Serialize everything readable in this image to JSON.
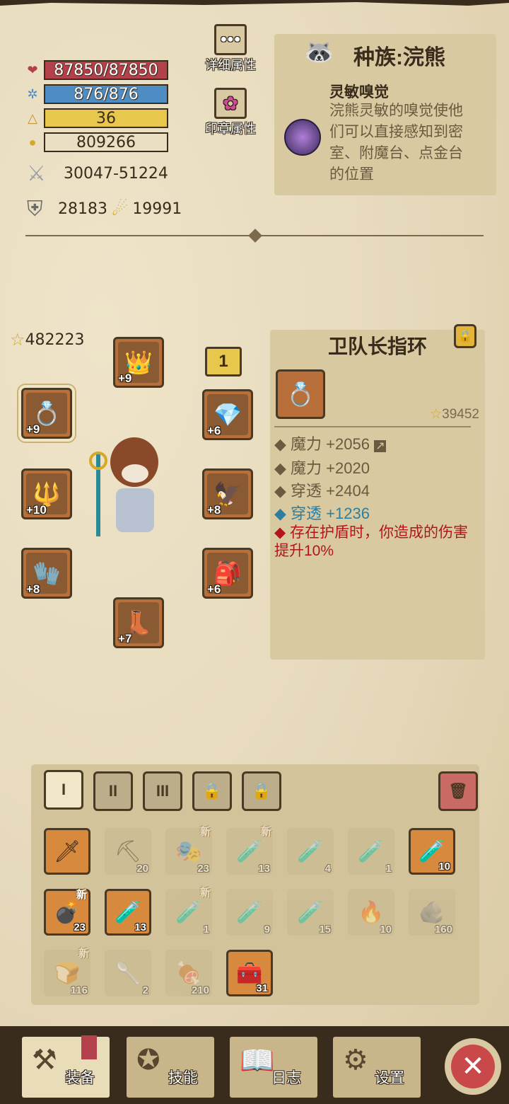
{
  "stats": {
    "hp": "87850/87850",
    "mp": "876/876",
    "level": "36",
    "gold": "809266",
    "attack": "30047-51224",
    "defense": "28183",
    "speed": "19991"
  },
  "buttons": {
    "detail_attr": "详细属性",
    "seal_attr": "印章属性"
  },
  "race": {
    "title": "种族:浣熊",
    "skill_name": "灵敏嗅觉",
    "skill_desc": "浣熊灵敏的嗅觉使他们可以直接感知到密室、附魔台、点金台的位置"
  },
  "equipment": {
    "total_score": "482223",
    "page_index": "1",
    "slots": [
      {
        "name": "helm",
        "level": "+9"
      },
      {
        "name": "ring",
        "level": "+9"
      },
      {
        "name": "amulet",
        "level": "+6"
      },
      {
        "name": "staff",
        "level": "+10"
      },
      {
        "name": "armor",
        "level": "+8"
      },
      {
        "name": "glove",
        "level": "+8"
      },
      {
        "name": "belt",
        "level": "+6"
      },
      {
        "name": "boots",
        "level": "+7"
      }
    ]
  },
  "item_detail": {
    "title": "卫队长指环",
    "score": "39452",
    "attr1": "魔力 +2056",
    "attr2": "魔力 +2020",
    "attr3": "穿透 +2404",
    "attr4": "穿透 +1236",
    "special": "存在护盾时，你造成的伤害提升10%",
    "colors": {
      "special": "#b3151b",
      "blue": "#2d7fa0"
    }
  },
  "inventory": {
    "tabs": [
      "I",
      "II",
      "III"
    ],
    "items": [
      {
        "icon": "sword",
        "count": "",
        "new": false,
        "dim": false
      },
      {
        "icon": "pickaxe",
        "count": "20",
        "new": false,
        "dim": true
      },
      {
        "icon": "mask",
        "count": "23",
        "new": true,
        "dim": true
      },
      {
        "icon": "potion-red",
        "count": "13",
        "new": true,
        "dim": true
      },
      {
        "icon": "potion-green",
        "count": "4",
        "new": false,
        "dim": true
      },
      {
        "icon": "potion-red",
        "count": "1",
        "new": false,
        "dim": true
      },
      {
        "icon": "potion-yellow",
        "count": "10",
        "new": false,
        "dim": false
      },
      {
        "icon": "bomb",
        "count": "23",
        "new": true,
        "dim": false
      },
      {
        "icon": "potion-pink",
        "count": "13",
        "new": false,
        "dim": false
      },
      {
        "icon": "potion-red",
        "count": "1",
        "new": true,
        "dim": true
      },
      {
        "icon": "potion-blue",
        "count": "9",
        "new": false,
        "dim": true
      },
      {
        "icon": "potion-red",
        "count": "15",
        "new": false,
        "dim": true
      },
      {
        "icon": "potion-fire",
        "count": "10",
        "new": false,
        "dim": true
      },
      {
        "icon": "stone",
        "count": "160",
        "new": false,
        "dim": true
      },
      {
        "icon": "food",
        "count": "116",
        "new": true,
        "dim": true
      },
      {
        "icon": "shovel",
        "count": "2",
        "new": false,
        "dim": true
      },
      {
        "icon": "meat",
        "count": "210",
        "new": false,
        "dim": true
      },
      {
        "icon": "chest",
        "count": "31",
        "new": false,
        "dim": false
      }
    ]
  },
  "nav": {
    "equip": "装备",
    "skill": "技能",
    "log": "日志",
    "settings": "设置"
  }
}
